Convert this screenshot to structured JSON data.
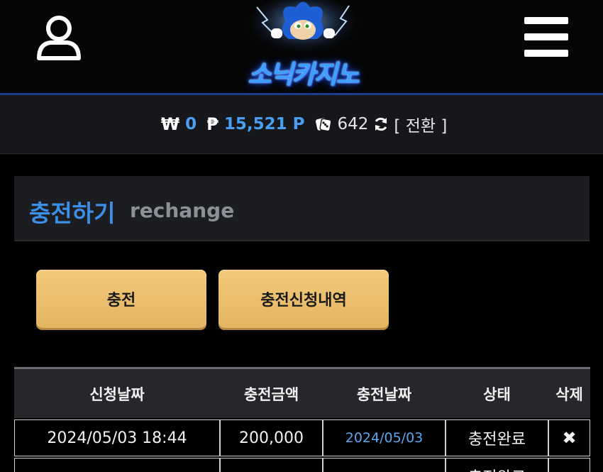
{
  "header": {
    "logo_text": "소닉카지노",
    "user_icon": "user-icon",
    "menu_icon": "hamburger-menu-icon"
  },
  "balance": {
    "won_symbol": "₩",
    "won_value": "0",
    "point_symbol": "₱",
    "point_value": "15,521 P",
    "dice_value": "642",
    "swap_label": "[ 전환 ]"
  },
  "section": {
    "title": "충전하기",
    "subtitle": "rechange"
  },
  "buttons": {
    "charge": "충전",
    "history": "충전신청내역"
  },
  "table": {
    "headers": [
      "신청날짜",
      "충전금액",
      "충전날짜",
      "상태",
      "삭제"
    ],
    "rows": [
      {
        "request_date": "2024/05/03 18:44",
        "amount": "200,000",
        "charge_date": "2024/05/03",
        "status": "충전완료",
        "delete": "✖"
      },
      {
        "request_date": "",
        "amount": "",
        "charge_date": "",
        "status": "충전완료",
        "delete": ""
      }
    ]
  },
  "colors": {
    "accent_blue": "#3b8fe6",
    "button_gold": "#e9bd6d",
    "header_border": "#1c3b8c"
  }
}
